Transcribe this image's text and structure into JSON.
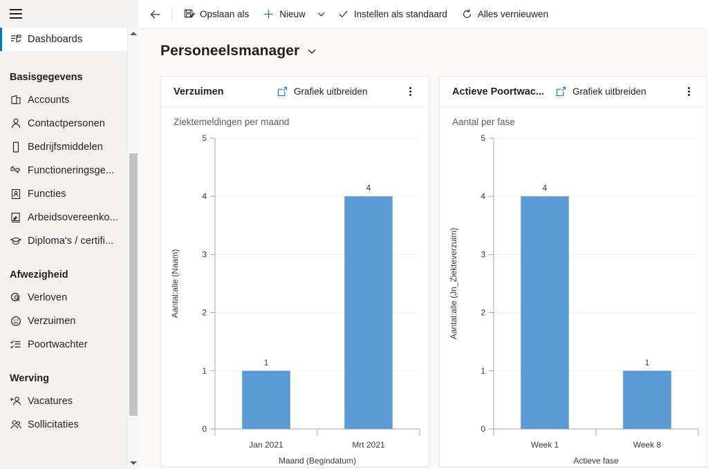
{
  "sidebar": {
    "menu_icon": "hamburger-icon",
    "scroll_up": "scroll-up-arrow",
    "scroll_down": "scroll-down-arrow",
    "items": [
      {
        "type": "item",
        "label": "Dashboards",
        "icon": "dashboard-icon",
        "selected": true
      },
      {
        "type": "group",
        "label": "Basisgegevens"
      },
      {
        "type": "item",
        "label": "Accounts",
        "icon": "account-icon",
        "selected": false
      },
      {
        "type": "item",
        "label": "Contactpersonen",
        "icon": "person-icon",
        "selected": false
      },
      {
        "type": "item",
        "label": "Bedrijfsmiddelen",
        "icon": "device-icon",
        "selected": false
      },
      {
        "type": "item",
        "label": "Functioneringsge...",
        "icon": "feedback-icon",
        "selected": false
      },
      {
        "type": "item",
        "label": "Functies",
        "icon": "badge-icon",
        "selected": false
      },
      {
        "type": "item",
        "label": "Arbeidsovereenko...",
        "icon": "contract-sign-icon",
        "selected": false
      },
      {
        "type": "item",
        "label": "Diploma's / certifi...",
        "icon": "graduation-cap-icon",
        "selected": false
      },
      {
        "type": "group",
        "label": "Afwezigheid"
      },
      {
        "type": "item",
        "label": "Verloven",
        "icon": "leave-search-icon",
        "selected": false
      },
      {
        "type": "item",
        "label": "Verzuimen",
        "icon": "sad-face-icon",
        "selected": false
      },
      {
        "type": "item",
        "label": "Poortwachter",
        "icon": "checklist-icon",
        "selected": false
      },
      {
        "type": "group",
        "label": "Werving"
      },
      {
        "type": "item",
        "label": "Vacatures",
        "icon": "add-person-icon",
        "selected": false
      },
      {
        "type": "item",
        "label": "Sollicitaties",
        "icon": "people-icon",
        "selected": false
      }
    ]
  },
  "commandbar": {
    "back_label": "back-arrow",
    "save_as": "Opslaan als",
    "new": "Nieuw",
    "new_chevron": "chevron-down-icon",
    "set_default": "Instellen als standaard",
    "refresh_all": "Alles vernieuwen"
  },
  "header": {
    "title": "Personeelsmanager",
    "title_chevron": "chevron-down-icon"
  },
  "cards": [
    {
      "title": "Verzuimen",
      "expand_label": "Grafiek uitbreiden",
      "more_label": "more-options"
    },
    {
      "title": "Actieve Poortwac...",
      "expand_label": "Grafiek uitbreiden",
      "more_label": "more-options"
    }
  ],
  "chart_data": [
    {
      "type": "bar",
      "title": "Ziektemeldingen per maand",
      "categories": [
        "Jan 2021",
        "Mrt 2021"
      ],
      "values": [
        1,
        4
      ],
      "xlabel": "Maand (Begindatum)",
      "ylabel": "Aantal:alle (Naam)",
      "yticks": [
        0,
        1,
        2,
        3,
        4,
        5
      ],
      "ylim": [
        0,
        5
      ],
      "grid": true,
      "legend": "none",
      "bar_color": "#5b9bd5"
    },
    {
      "type": "bar",
      "title": "Aantal per fase",
      "categories": [
        "Week 1",
        "Week 8"
      ],
      "values": [
        4,
        1
      ],
      "xlabel": "Actieve fase",
      "ylabel": "Aantal:alle (Jn_Ziekteverzuim)",
      "yticks": [
        0,
        1,
        2,
        3,
        4,
        5
      ],
      "ylim": [
        0,
        5
      ],
      "grid": true,
      "legend": "none",
      "bar_color": "#5b9bd5"
    }
  ],
  "colors": {
    "accent": "#0078d4",
    "bar": "#5b9bd5",
    "sidebar_bg": "#f3f2f1",
    "canvas_bg": "#faf9f8"
  }
}
